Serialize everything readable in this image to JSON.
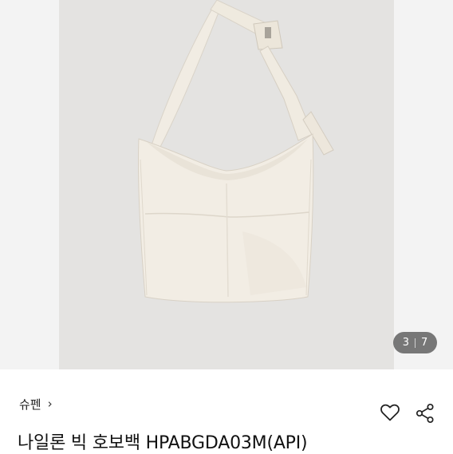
{
  "gallery": {
    "current": "3",
    "total": "7"
  },
  "product": {
    "brand": "슈펜",
    "brand_chevron": "›",
    "title": "나일론 빅 호보백 HPABGDA03M(API)"
  },
  "icons": {
    "like": "heart-outline-icon",
    "share": "share-icon"
  },
  "colors": {
    "photo_background": "#e4e3e1",
    "bag": "#f2ede4",
    "counter_badge": "#464646"
  }
}
